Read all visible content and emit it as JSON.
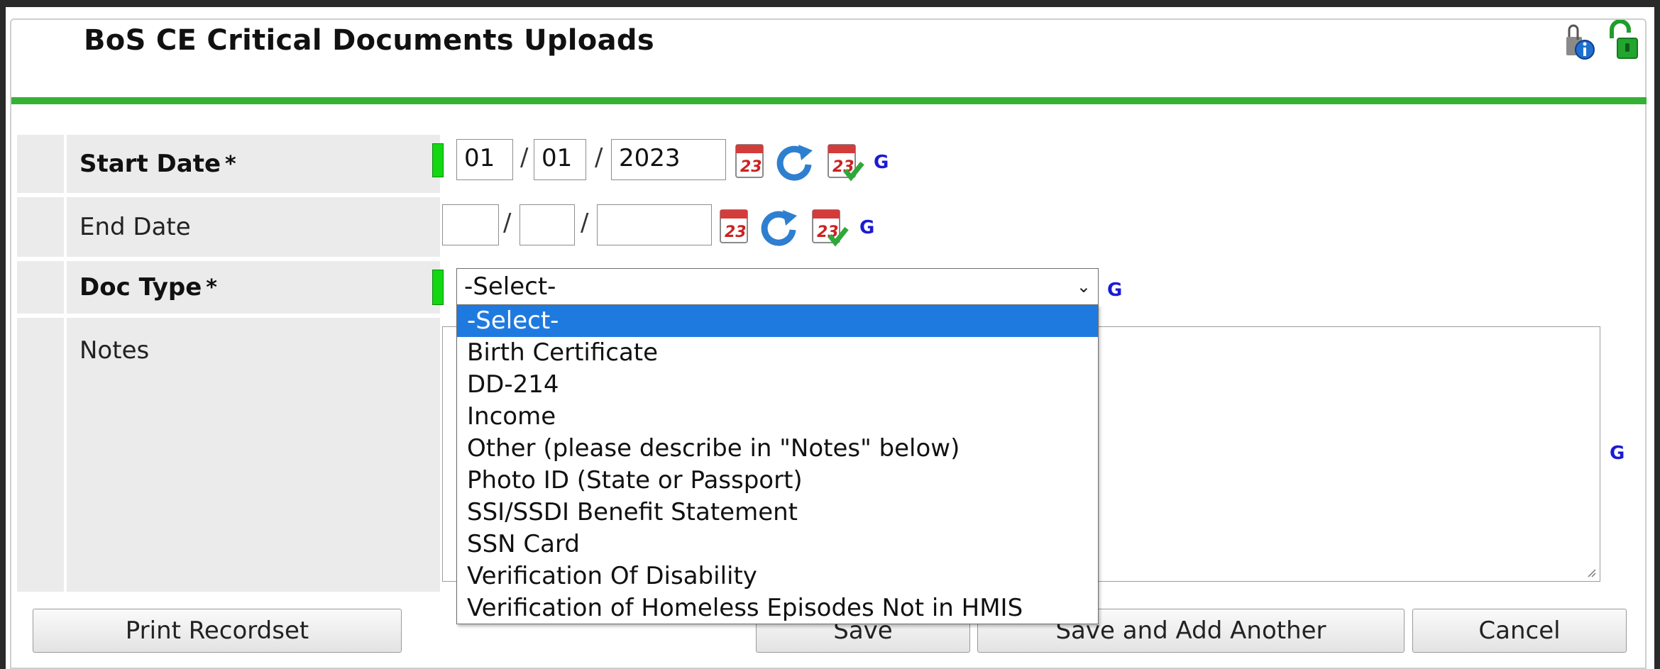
{
  "header": {
    "title": "BoS CE Critical Documents Uploads"
  },
  "fields": {
    "start_date": {
      "label": "Start Date",
      "required_mark": "*",
      "month": "01",
      "day": "01",
      "year": "2023"
    },
    "end_date": {
      "label": "End Date",
      "month": "",
      "day": "",
      "year": ""
    },
    "doc_type": {
      "label": "Doc Type",
      "required_mark": "*",
      "selected": "-Select-",
      "options": [
        "-Select-",
        "Birth Certificate",
        "DD-214",
        "Income",
        "Other (please describe in \"Notes\" below)",
        "Photo ID (State or Passport)",
        "SSI/SSDI Benefit Statement",
        "SSN Card",
        "Verification Of Disability",
        "Verification of Homeless Episodes Not in HMIS"
      ]
    },
    "notes": {
      "label": "Notes",
      "value": ""
    }
  },
  "date_separator": "/",
  "google_link": "G",
  "buttons": {
    "print": "Print Recordset",
    "save": "Save",
    "save_add": "Save and Add Another",
    "cancel": "Cancel"
  },
  "colors": {
    "accent_green": "#35b034",
    "required_green": "#14d714",
    "selection_blue": "#1f7ae0",
    "link_blue": "#1a1ad6"
  }
}
